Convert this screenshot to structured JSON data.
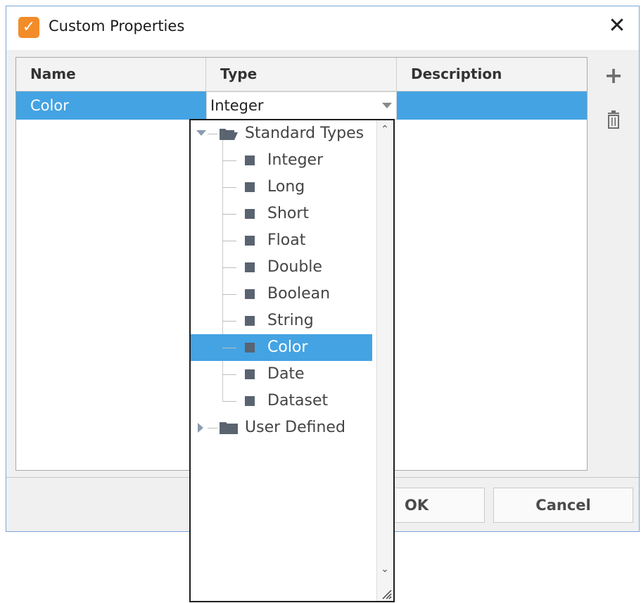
{
  "window": {
    "title": "Custom Properties",
    "close_glyph": "✕",
    "app_icon": "custom-properties-app-icon"
  },
  "table": {
    "columns": [
      "Name",
      "Type",
      "Description"
    ],
    "rows": [
      {
        "name": "Color",
        "type": "Integer",
        "description": ""
      }
    ]
  },
  "toolbar": {
    "add_glyph": "+",
    "add_icon": "plus-icon",
    "delete_icon": "trash-icon"
  },
  "buttons": {
    "ok": "OK",
    "cancel": "Cancel"
  },
  "type_dropdown": {
    "selected": "Color",
    "groups": [
      {
        "label": "Standard Types",
        "expanded": true,
        "items": [
          "Integer",
          "Long",
          "Short",
          "Float",
          "Double",
          "Boolean",
          "String",
          "Color",
          "Date",
          "Dataset"
        ]
      },
      {
        "label": "User Defined",
        "expanded": false,
        "items": []
      }
    ]
  },
  "colors": {
    "selection": "#44a3e3",
    "app_icon": "#f28c28",
    "window_border": "#7aa6d6"
  }
}
